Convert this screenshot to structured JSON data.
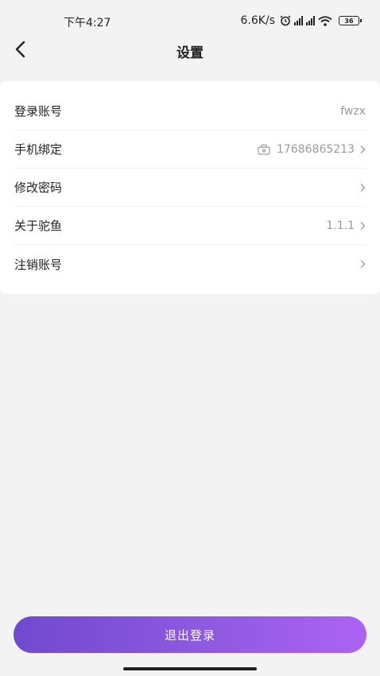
{
  "status_bar": {
    "time": "下午4:27",
    "network_speed": "6.6K/s",
    "battery": "36"
  },
  "nav": {
    "title": "设置"
  },
  "settings": {
    "account": {
      "label": "登录账号",
      "value": "fwzx"
    },
    "phone": {
      "label": "手机绑定",
      "value": "17686865213"
    },
    "password": {
      "label": "修改密码"
    },
    "about": {
      "label": "关于驼鱼",
      "value": "1.1.1"
    },
    "cancel_account": {
      "label": "注销账号"
    }
  },
  "logout_button": "退出登录",
  "icons": [
    "back-arrow-icon",
    "alarm-icon",
    "signal-icon",
    "wifi-icon",
    "battery-icon",
    "lock-icon",
    "chevron-right-icon"
  ]
}
